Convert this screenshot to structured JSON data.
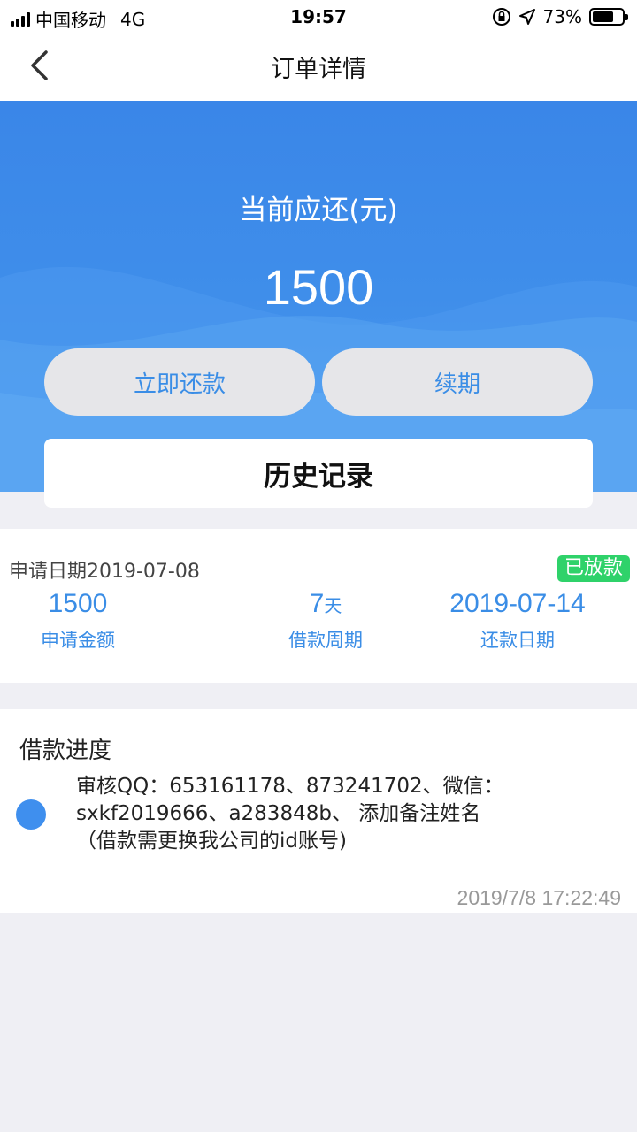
{
  "status_bar": {
    "carrier": "中国移动",
    "network": "4G",
    "time": "19:57",
    "battery": "73%",
    "battery_level": 0.73
  },
  "nav": {
    "title": "订单详情"
  },
  "hero": {
    "label": "当前应还(元)",
    "amount": "1500",
    "pay_button": "立即还款",
    "renew_button": "续期",
    "history_button": "历史记录"
  },
  "order": {
    "apply_date": "申请日期2019-07-08",
    "status": "已放款",
    "amount_value": "1500",
    "amount_label": "申请金额",
    "period_value": "7",
    "period_unit": "天",
    "period_label": "借款周期",
    "due_date_value": "2019-07-14",
    "due_date_label": "还款日期"
  },
  "progress": {
    "title": "借款进度",
    "line1": "审核QQ：653161178、873241702、微信：",
    "line2": "sxkf2019666、a283848b、 添加备注姓名",
    "line3": "（借款需更换我公司的id账号)",
    "time": "2019/7/8 17:22:49"
  },
  "colors": {
    "accent": "#3a8de6",
    "badge": "#2fd26a",
    "hero_bg": "#3f8eea"
  },
  "icons": {
    "back": "chevron-left-icon",
    "lock": "orientation-lock-icon",
    "location": "location-arrow-icon",
    "battery": "battery-icon"
  }
}
